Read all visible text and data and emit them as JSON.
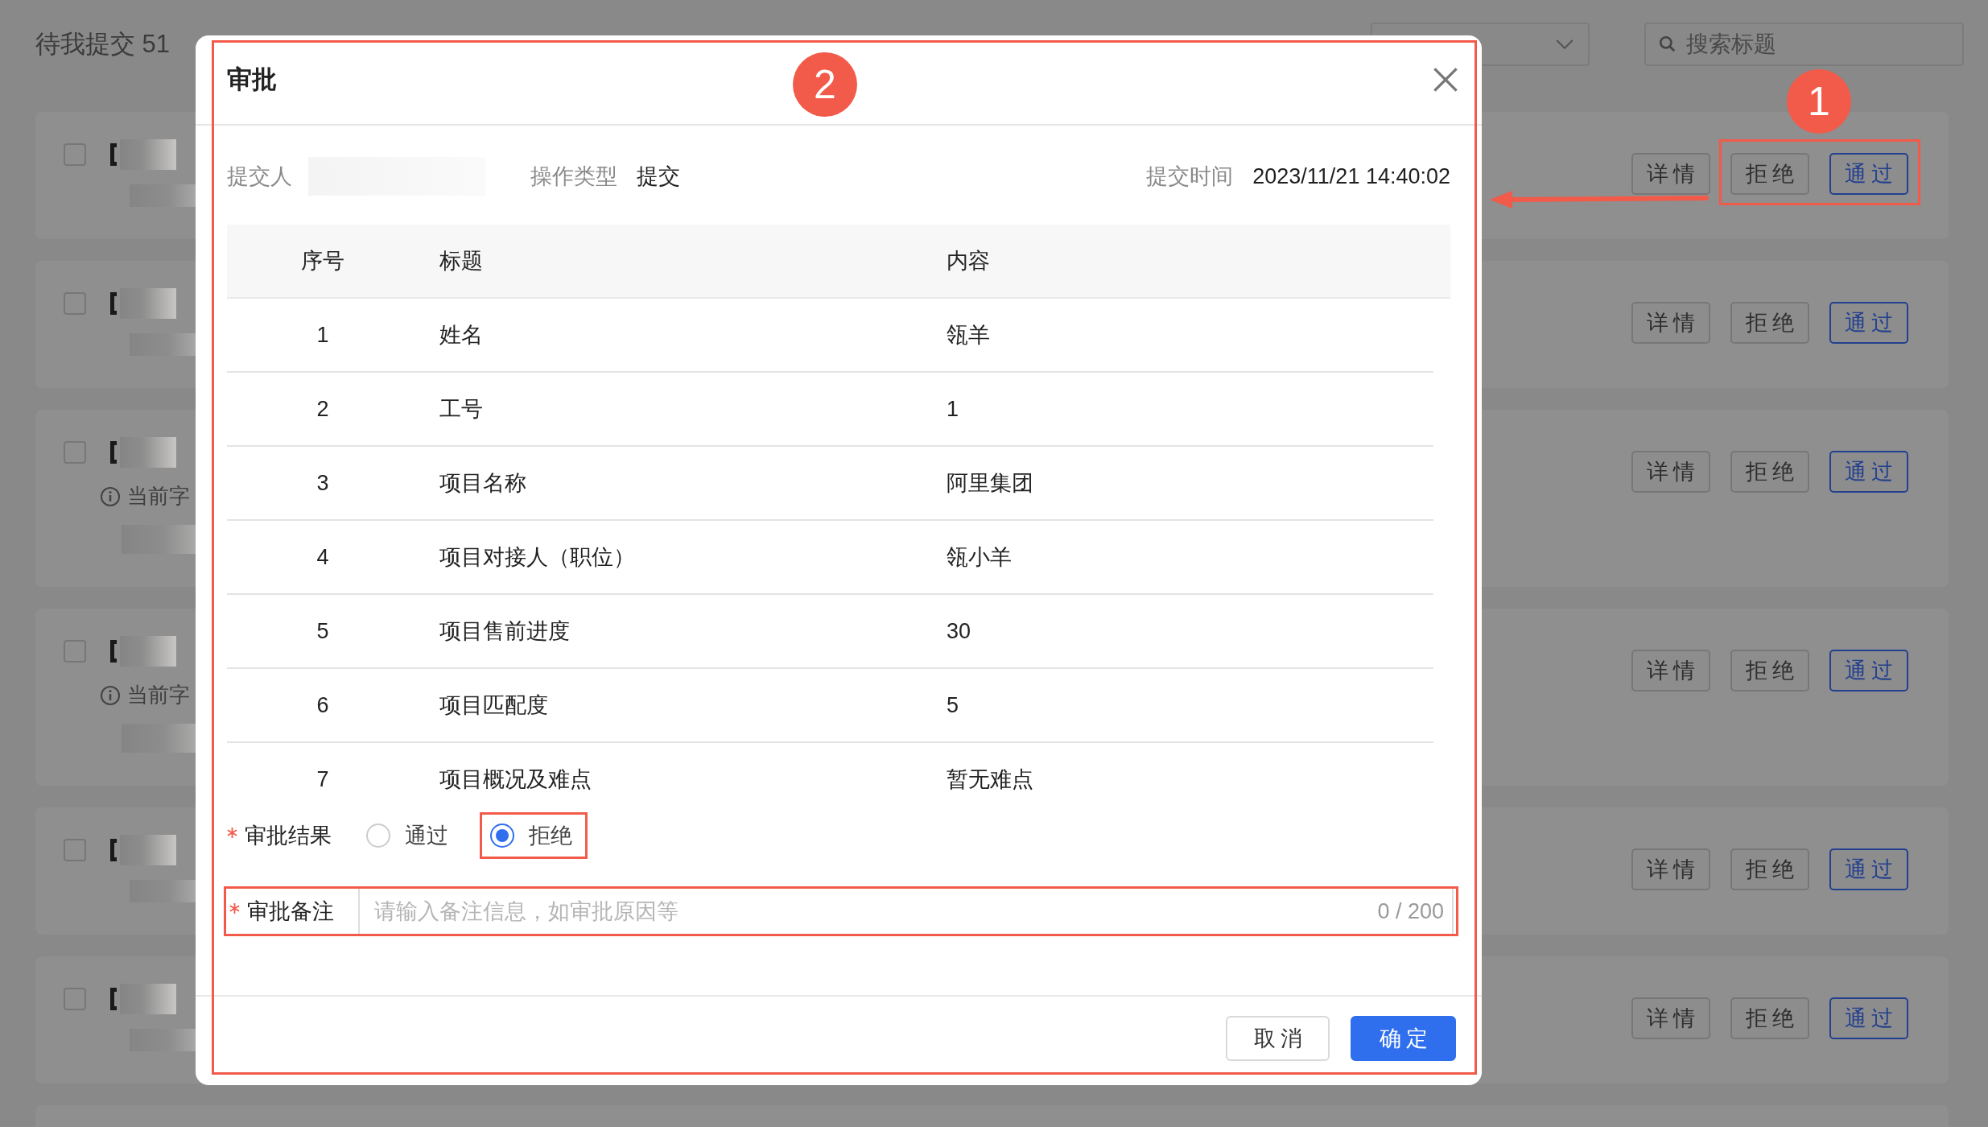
{
  "tabs": [
    {
      "label": "待我提交 51"
    }
  ],
  "search": {
    "placeholder": "搜索标题"
  },
  "cards": [
    {
      "kind": "plain",
      "checked": false,
      "actions": [
        {
          "label": "详情",
          "kind": "default"
        },
        {
          "label": "拒绝",
          "kind": "default"
        },
        {
          "label": "通过",
          "kind": "primary"
        }
      ]
    },
    {
      "kind": "plain",
      "checked": false,
      "actions": [
        {
          "label": "详情",
          "kind": "default"
        },
        {
          "label": "拒绝",
          "kind": "default"
        },
        {
          "label": "通过",
          "kind": "primary"
        }
      ]
    },
    {
      "kind": "info",
      "checked": false,
      "info_text": "当前字",
      "actions": [
        {
          "label": "详情",
          "kind": "default"
        },
        {
          "label": "拒绝",
          "kind": "default"
        },
        {
          "label": "通过",
          "kind": "primary"
        }
      ]
    },
    {
      "kind": "info",
      "checked": false,
      "info_text": "当前字",
      "actions": [
        {
          "label": "详情",
          "kind": "default"
        },
        {
          "label": "拒绝",
          "kind": "default"
        },
        {
          "label": "通过",
          "kind": "primary"
        }
      ]
    },
    {
      "kind": "plain",
      "checked": false,
      "actions": [
        {
          "label": "详情",
          "kind": "default"
        },
        {
          "label": "拒绝",
          "kind": "default"
        },
        {
          "label": "通过",
          "kind": "primary"
        }
      ]
    },
    {
      "kind": "plain",
      "checked": false,
      "actions": [
        {
          "label": "详情",
          "kind": "default"
        },
        {
          "label": "拒绝",
          "kind": "default"
        },
        {
          "label": "通过",
          "kind": "primary"
        }
      ]
    }
  ],
  "annotations": [
    {
      "label": "1"
    },
    {
      "label": "2"
    }
  ],
  "dialog": {
    "title": "审批",
    "submitter_label": "提交人",
    "type_label": "操作类型",
    "type_value": "提交",
    "time_label": "提交时间",
    "time_value": "2023/11/21 14:40:02",
    "table": {
      "columns": [
        "序号",
        "标题",
        "内容"
      ],
      "rows": [
        [
          "1",
          "姓名",
          "瓴羊"
        ],
        [
          "2",
          "工号",
          "1"
        ],
        [
          "3",
          "项目名称",
          "阿里集团"
        ],
        [
          "4",
          "项目对接人（职位）",
          "瓴小羊"
        ],
        [
          "5",
          "项目售前进度",
          "30"
        ],
        [
          "6",
          "项目匹配度",
          "5"
        ],
        [
          "7",
          "项目概况及难点",
          "暂无难点"
        ]
      ]
    },
    "result": {
      "label": "审批结果",
      "required": true,
      "options": [
        {
          "label": "通过",
          "selected": false
        },
        {
          "label": "拒绝",
          "selected": true
        }
      ]
    },
    "remark": {
      "label": "审批备注",
      "required": true,
      "placeholder": "请输入备注信息，如审批原因等",
      "counter": "0 / 200"
    },
    "buttons": [
      {
        "label": "取消",
        "kind": "default"
      },
      {
        "label": "确定",
        "kind": "primary"
      }
    ]
  }
}
